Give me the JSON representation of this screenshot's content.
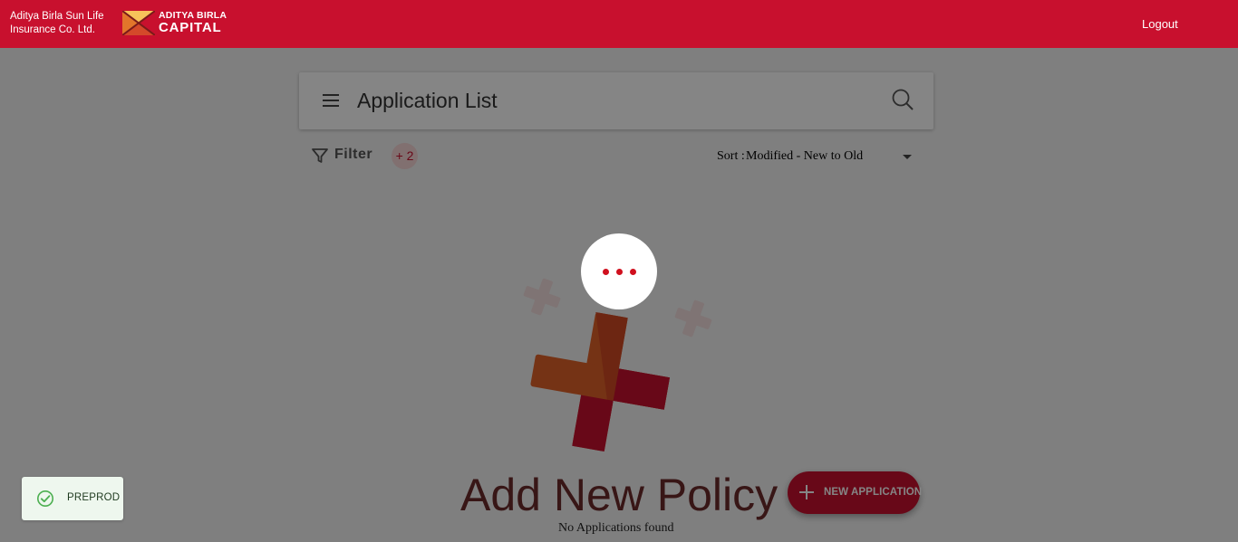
{
  "header": {
    "company_line1": "Aditya Birla Sun Life",
    "company_line2": "Insurance Co. Ltd.",
    "logo_line1": "ADITYA BIRLA",
    "logo_line2": "CAPITAL",
    "logout_label": "Logout",
    "brand_color": "#c8102e"
  },
  "toolbar": {
    "menu_icon": "hamburger-icon",
    "title": "Application List",
    "search_icon": "search-icon"
  },
  "filter": {
    "icon": "filter-icon",
    "label": "Filter",
    "count": "+ 2"
  },
  "sort": {
    "prefix": "Sort :",
    "selected": "Modified - New to Old"
  },
  "empty_state": {
    "title": "Add New Policy",
    "message": "No Applications found"
  },
  "fab": {
    "icon": "plus-icon",
    "label": "NEW APPLICATION"
  },
  "loader": {
    "icon": "loading-dots-icon"
  },
  "environment": {
    "icon": "check-circle-icon",
    "label": "PREPROD",
    "color": "#4caf50"
  }
}
